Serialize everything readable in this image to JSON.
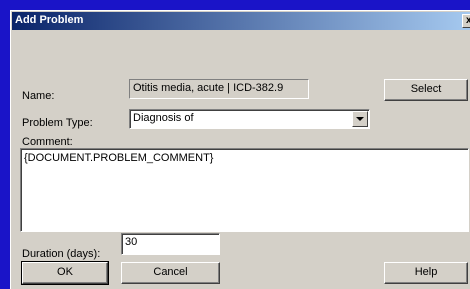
{
  "window": {
    "title": "Add Problem",
    "close_label": "x"
  },
  "form": {
    "name_label": "Name:",
    "name_value": "Otitis media, acute | ICD-382.9",
    "problem_type_label": "Problem Type:",
    "problem_type_value": "Diagnosis of",
    "comment_label": "Comment:",
    "comment_value": "{DOCUMENT.PROBLEM_COMMENT}",
    "duration_label": "Duration (days):",
    "duration_value": "30"
  },
  "buttons": {
    "select": "Select",
    "ok": "OK",
    "cancel": "Cancel",
    "help": "Help"
  }
}
